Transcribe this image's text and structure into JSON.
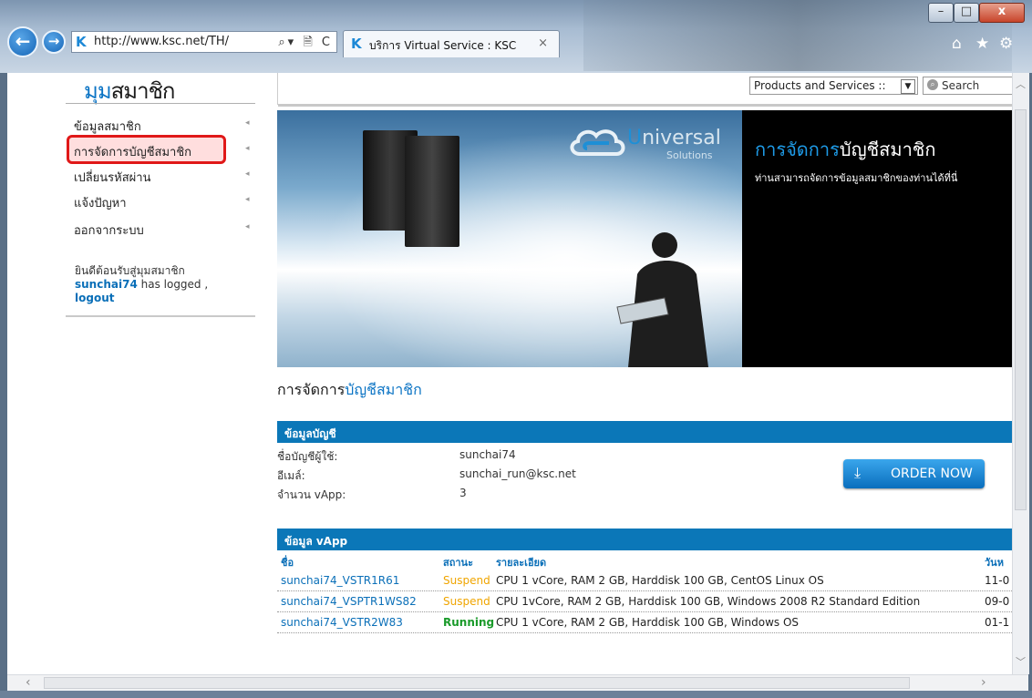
{
  "browser": {
    "url": "http://www.ksc.net/TH/",
    "tab_title": "บริการ Virtual Service : KSC",
    "tab_close": "×",
    "address_tools": "▾ 🗎 C",
    "window_controls": {
      "minimize": "–",
      "maximize": "□",
      "close": "x"
    },
    "toolbar_icons": [
      "home-icon",
      "favorites-icon",
      "settings-icon"
    ]
  },
  "page": {
    "brand": {
      "part1": "มุม",
      "part2": "สมาชิก"
    },
    "header": {
      "products_select": "Products and Services ::",
      "search_label": "Search"
    },
    "sidebar": {
      "items": [
        {
          "label": "ข้อมูลสมาชิก"
        },
        {
          "label": "การจัดการบัญชีสมาชิก"
        },
        {
          "label": "เปลี่ยนรหัสผ่าน"
        },
        {
          "label": "แจ้งปัญหา"
        },
        {
          "label": "ออกจากระบบ"
        }
      ],
      "welcome_text": "ยินดีต้อนรับสู่มุมสมาชิก",
      "username": "sunchai74",
      "logged_text": " has logged ,",
      "logout": "logout"
    },
    "banner": {
      "logo_text": "niversal",
      "logo_sub": "Solutions",
      "title_part1": "การจัดการ",
      "title_part2": "บัญชีสมาชิก",
      "subtitle": "ท่านสามารถจัดการข้อมูลสมาชิกของท่านได้ที่นี่"
    },
    "heading": {
      "part1": "การจัดการ",
      "part2": "บัญชีสมาชิก"
    },
    "account": {
      "section_title": "ข้อมูลบัญชี",
      "fields": [
        {
          "label": "ชื่อบัญชีผู้ใช้:",
          "value": "sunchai74"
        },
        {
          "label": "อีเมล์:",
          "value": "sunchai_run@ksc.net"
        },
        {
          "label": "จำนวน vApp:",
          "value": "3"
        }
      ],
      "order_button": "ORDER NOW"
    },
    "vapp": {
      "section_title": "ข้อมูล vApp",
      "headers": {
        "name": "ชื่อ",
        "status": "สถานะ",
        "detail": "รายละเอียด",
        "date": "วันห"
      },
      "rows": [
        {
          "name": "sunchai74_VSTR1R61",
          "status": "Suspend",
          "detail": "CPU 1 vCore, RAM 2 GB, Harddisk 100 GB, CentOS Linux OS",
          "date": "11-0"
        },
        {
          "name": "sunchai74_VSPTR1WS82",
          "status": "Suspend",
          "detail": "CPU 1vCore, RAM 2 GB, Harddisk 100 GB, Windows 2008 R2 Standard Edition",
          "date": "09-0"
        },
        {
          "name": "sunchai74_VSTR2W83",
          "status": "Running",
          "detail": "CPU 1 vCore, RAM 2 GB, Harddisk 100 GB, Windows OS",
          "date": "01-1"
        }
      ]
    },
    "colors": {
      "accent": "#0b77b8",
      "suspend": "#f0a500",
      "running": "#1a9a2a",
      "highlight": "#e01818"
    }
  }
}
